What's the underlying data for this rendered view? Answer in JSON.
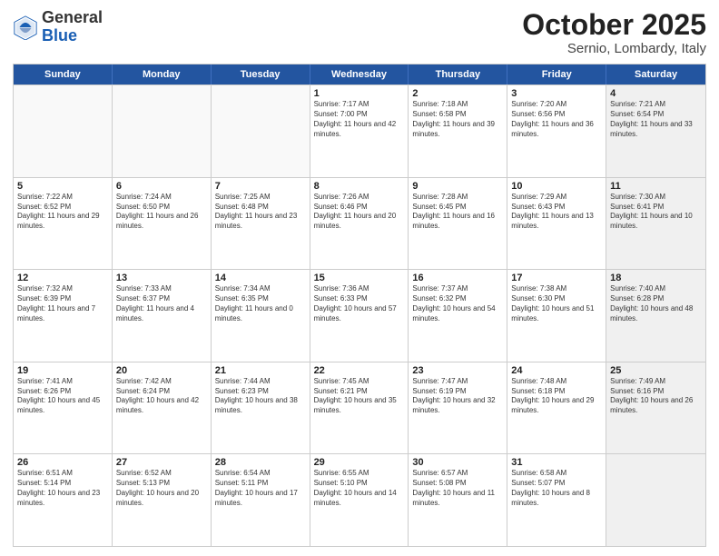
{
  "logo": {
    "general": "General",
    "blue": "Blue"
  },
  "title": "October 2025",
  "subtitle": "Sernio, Lombardy, Italy",
  "days": [
    "Sunday",
    "Monday",
    "Tuesday",
    "Wednesday",
    "Thursday",
    "Friday",
    "Saturday"
  ],
  "weeks": [
    [
      {
        "num": "",
        "sunrise": "",
        "sunset": "",
        "daylight": "",
        "empty": true
      },
      {
        "num": "",
        "sunrise": "",
        "sunset": "",
        "daylight": "",
        "empty": true
      },
      {
        "num": "",
        "sunrise": "",
        "sunset": "",
        "daylight": "",
        "empty": true
      },
      {
        "num": "1",
        "sunrise": "Sunrise: 7:17 AM",
        "sunset": "Sunset: 7:00 PM",
        "daylight": "Daylight: 11 hours and 42 minutes."
      },
      {
        "num": "2",
        "sunrise": "Sunrise: 7:18 AM",
        "sunset": "Sunset: 6:58 PM",
        "daylight": "Daylight: 11 hours and 39 minutes."
      },
      {
        "num": "3",
        "sunrise": "Sunrise: 7:20 AM",
        "sunset": "Sunset: 6:56 PM",
        "daylight": "Daylight: 11 hours and 36 minutes."
      },
      {
        "num": "4",
        "sunrise": "Sunrise: 7:21 AM",
        "sunset": "Sunset: 6:54 PM",
        "daylight": "Daylight: 11 hours and 33 minutes."
      }
    ],
    [
      {
        "num": "5",
        "sunrise": "Sunrise: 7:22 AM",
        "sunset": "Sunset: 6:52 PM",
        "daylight": "Daylight: 11 hours and 29 minutes."
      },
      {
        "num": "6",
        "sunrise": "Sunrise: 7:24 AM",
        "sunset": "Sunset: 6:50 PM",
        "daylight": "Daylight: 11 hours and 26 minutes."
      },
      {
        "num": "7",
        "sunrise": "Sunrise: 7:25 AM",
        "sunset": "Sunset: 6:48 PM",
        "daylight": "Daylight: 11 hours and 23 minutes."
      },
      {
        "num": "8",
        "sunrise": "Sunrise: 7:26 AM",
        "sunset": "Sunset: 6:46 PM",
        "daylight": "Daylight: 11 hours and 20 minutes."
      },
      {
        "num": "9",
        "sunrise": "Sunrise: 7:28 AM",
        "sunset": "Sunset: 6:45 PM",
        "daylight": "Daylight: 11 hours and 16 minutes."
      },
      {
        "num": "10",
        "sunrise": "Sunrise: 7:29 AM",
        "sunset": "Sunset: 6:43 PM",
        "daylight": "Daylight: 11 hours and 13 minutes."
      },
      {
        "num": "11",
        "sunrise": "Sunrise: 7:30 AM",
        "sunset": "Sunset: 6:41 PM",
        "daylight": "Daylight: 11 hours and 10 minutes."
      }
    ],
    [
      {
        "num": "12",
        "sunrise": "Sunrise: 7:32 AM",
        "sunset": "Sunset: 6:39 PM",
        "daylight": "Daylight: 11 hours and 7 minutes."
      },
      {
        "num": "13",
        "sunrise": "Sunrise: 7:33 AM",
        "sunset": "Sunset: 6:37 PM",
        "daylight": "Daylight: 11 hours and 4 minutes."
      },
      {
        "num": "14",
        "sunrise": "Sunrise: 7:34 AM",
        "sunset": "Sunset: 6:35 PM",
        "daylight": "Daylight: 11 hours and 0 minutes."
      },
      {
        "num": "15",
        "sunrise": "Sunrise: 7:36 AM",
        "sunset": "Sunset: 6:33 PM",
        "daylight": "Daylight: 10 hours and 57 minutes."
      },
      {
        "num": "16",
        "sunrise": "Sunrise: 7:37 AM",
        "sunset": "Sunset: 6:32 PM",
        "daylight": "Daylight: 10 hours and 54 minutes."
      },
      {
        "num": "17",
        "sunrise": "Sunrise: 7:38 AM",
        "sunset": "Sunset: 6:30 PM",
        "daylight": "Daylight: 10 hours and 51 minutes."
      },
      {
        "num": "18",
        "sunrise": "Sunrise: 7:40 AM",
        "sunset": "Sunset: 6:28 PM",
        "daylight": "Daylight: 10 hours and 48 minutes."
      }
    ],
    [
      {
        "num": "19",
        "sunrise": "Sunrise: 7:41 AM",
        "sunset": "Sunset: 6:26 PM",
        "daylight": "Daylight: 10 hours and 45 minutes."
      },
      {
        "num": "20",
        "sunrise": "Sunrise: 7:42 AM",
        "sunset": "Sunset: 6:24 PM",
        "daylight": "Daylight: 10 hours and 42 minutes."
      },
      {
        "num": "21",
        "sunrise": "Sunrise: 7:44 AM",
        "sunset": "Sunset: 6:23 PM",
        "daylight": "Daylight: 10 hours and 38 minutes."
      },
      {
        "num": "22",
        "sunrise": "Sunrise: 7:45 AM",
        "sunset": "Sunset: 6:21 PM",
        "daylight": "Daylight: 10 hours and 35 minutes."
      },
      {
        "num": "23",
        "sunrise": "Sunrise: 7:47 AM",
        "sunset": "Sunset: 6:19 PM",
        "daylight": "Daylight: 10 hours and 32 minutes."
      },
      {
        "num": "24",
        "sunrise": "Sunrise: 7:48 AM",
        "sunset": "Sunset: 6:18 PM",
        "daylight": "Daylight: 10 hours and 29 minutes."
      },
      {
        "num": "25",
        "sunrise": "Sunrise: 7:49 AM",
        "sunset": "Sunset: 6:16 PM",
        "daylight": "Daylight: 10 hours and 26 minutes."
      }
    ],
    [
      {
        "num": "26",
        "sunrise": "Sunrise: 6:51 AM",
        "sunset": "Sunset: 5:14 PM",
        "daylight": "Daylight: 10 hours and 23 minutes."
      },
      {
        "num": "27",
        "sunrise": "Sunrise: 6:52 AM",
        "sunset": "Sunset: 5:13 PM",
        "daylight": "Daylight: 10 hours and 20 minutes."
      },
      {
        "num": "28",
        "sunrise": "Sunrise: 6:54 AM",
        "sunset": "Sunset: 5:11 PM",
        "daylight": "Daylight: 10 hours and 17 minutes."
      },
      {
        "num": "29",
        "sunrise": "Sunrise: 6:55 AM",
        "sunset": "Sunset: 5:10 PM",
        "daylight": "Daylight: 10 hours and 14 minutes."
      },
      {
        "num": "30",
        "sunrise": "Sunrise: 6:57 AM",
        "sunset": "Sunset: 5:08 PM",
        "daylight": "Daylight: 10 hours and 11 minutes."
      },
      {
        "num": "31",
        "sunrise": "Sunrise: 6:58 AM",
        "sunset": "Sunset: 5:07 PM",
        "daylight": "Daylight: 10 hours and 8 minutes."
      },
      {
        "num": "",
        "sunrise": "",
        "sunset": "",
        "daylight": "",
        "empty": true
      }
    ]
  ]
}
